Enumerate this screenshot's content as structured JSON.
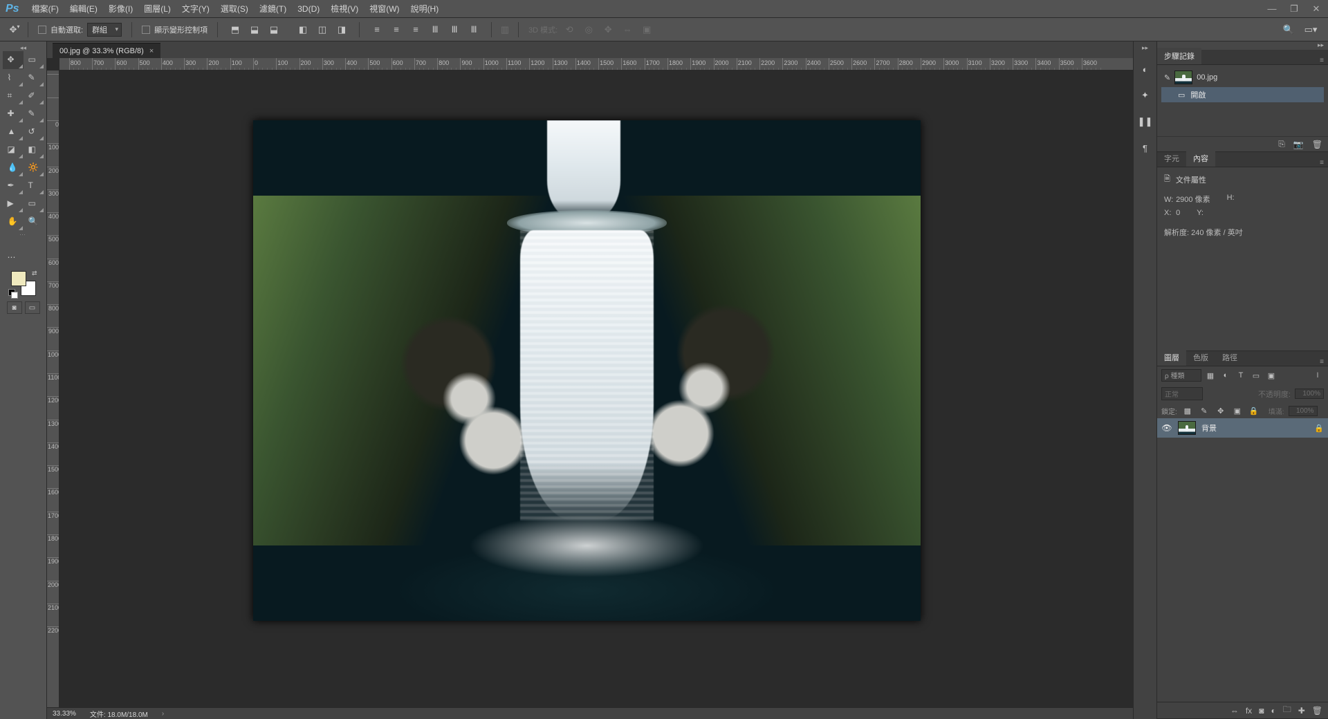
{
  "app": {
    "logo": "Ps"
  },
  "menu": [
    "檔案(F)",
    "編輯(E)",
    "影像(I)",
    "圖層(L)",
    "文字(Y)",
    "選取(S)",
    "濾鏡(T)",
    "3D(D)",
    "檢視(V)",
    "視窗(W)",
    "說明(H)"
  ],
  "options": {
    "auto_select_label": "自動選取:",
    "auto_select_value": "群組",
    "show_transform_label": "顯示變形控制項",
    "mode3d_label": "3D 模式:"
  },
  "doc_tab": {
    "title": "00.jpg @ 33.3% (RGB/8)"
  },
  "ruler_h": [
    -800,
    -700,
    -600,
    -500,
    -400,
    -300,
    -200,
    -100,
    0,
    100,
    200,
    300,
    400,
    500,
    600,
    700,
    800,
    900,
    1000,
    1100,
    1200,
    1300,
    1400,
    1500,
    1600,
    1700,
    1800,
    1900,
    2000,
    2100,
    2200,
    2300,
    2400,
    2500,
    2600,
    2700,
    2800,
    2900,
    3000,
    3100,
    3200,
    3300,
    3400,
    3500,
    3600
  ],
  "ruler_v": [
    0,
    100,
    200,
    300,
    400
  ],
  "statusbar": {
    "zoom": "33.33%",
    "docsize_label": "文件:",
    "docsize_value": "18.0M/18.0M"
  },
  "panels": {
    "history": {
      "tab": "步驟記錄",
      "filename": "00.jpg",
      "entry_label": "開啟"
    },
    "character_tabs": {
      "char_tab": "字元",
      "content_tab": "內容"
    },
    "props": {
      "title": "文件屬性",
      "w_label": "W:",
      "w_value": "2900 像素",
      "h_label": "H:",
      "x_label": "X:",
      "x_value": "0",
      "y_label": "Y:",
      "res_label": "解析度:",
      "res_value": "240 像素 / 英吋"
    },
    "layers": {
      "tabs": [
        "圖層",
        "色版",
        "路徑"
      ],
      "filter_placeholder": "ρ 種類",
      "blend_mode": "正常",
      "opacity_label": "不透明度:",
      "opacity_value": "100%",
      "lock_label": "鎖定:",
      "fill_label": "填滿:",
      "fill_value": "100%",
      "layer_name": "背景"
    }
  },
  "colors": {
    "foreground": "#efe9be",
    "background": "#ffffff"
  }
}
